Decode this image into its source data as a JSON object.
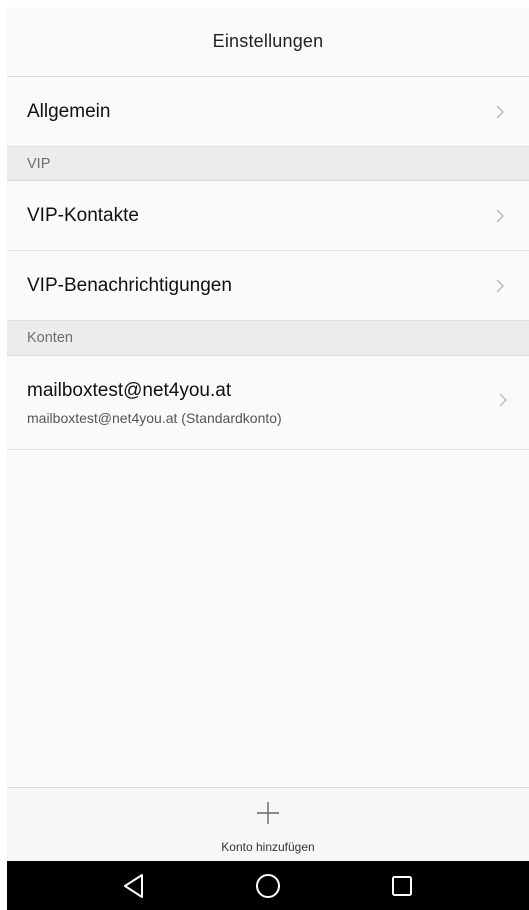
{
  "header": {
    "title": "Einstellungen"
  },
  "general": {
    "label": "Allgemein"
  },
  "sections": {
    "vip": "VIP",
    "accounts": "Konten"
  },
  "vip_items": [
    {
      "label": "VIP-Kontakte"
    },
    {
      "label": "VIP-Benachrichtigungen"
    }
  ],
  "account": {
    "primary": "mailboxtest@net4you.at",
    "secondary": "mailboxtest@net4you.at (Standardkonto)"
  },
  "bottom": {
    "add_account_label": "Konto hinzufügen"
  },
  "icons": {
    "chevron": "chevron-right-icon",
    "add": "plus-icon",
    "nav_back": "back-triangle-icon",
    "nav_home": "home-circle-icon",
    "nav_recents": "recents-square-icon"
  },
  "colors": {
    "background": "#fafafa",
    "section_bg": "#ececec",
    "navbar": "#000000"
  }
}
